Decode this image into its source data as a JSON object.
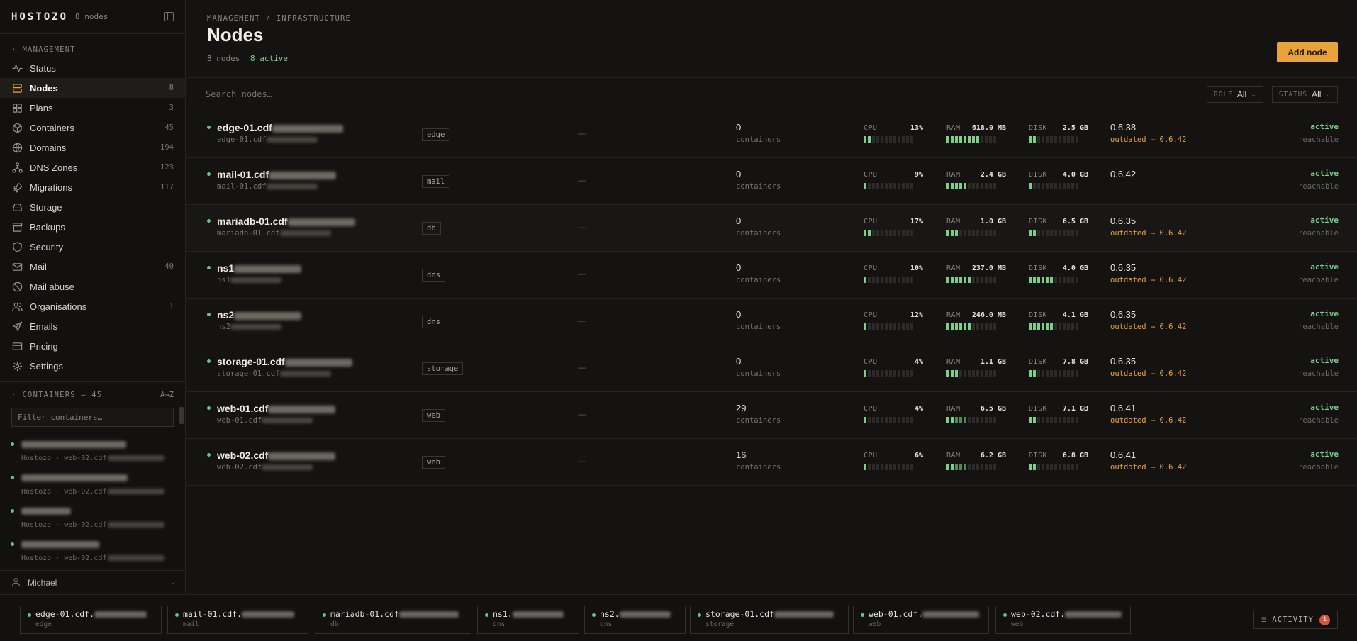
{
  "brand": {
    "logo": "HOSTOZO",
    "count": "8 nodes"
  },
  "sidebar": {
    "section": "MANAGEMENT",
    "items": [
      {
        "label": "Status",
        "icon": "activity-icon",
        "badge": ""
      },
      {
        "label": "Nodes",
        "icon": "server-icon",
        "badge": "8",
        "active": true
      },
      {
        "label": "Plans",
        "icon": "grid-icon",
        "badge": "3"
      },
      {
        "label": "Containers",
        "icon": "box-icon",
        "badge": "45"
      },
      {
        "label": "Domains",
        "icon": "globe-icon",
        "badge": "194"
      },
      {
        "label": "DNS Zones",
        "icon": "network-icon",
        "badge": "123"
      },
      {
        "label": "Migrations",
        "icon": "rocket-icon",
        "badge": "117"
      },
      {
        "label": "Storage",
        "icon": "storage-icon",
        "badge": ""
      },
      {
        "label": "Backups",
        "icon": "archive-icon",
        "badge": ""
      },
      {
        "label": "Security",
        "icon": "shield-icon",
        "badge": ""
      },
      {
        "label": "Mail",
        "icon": "mail-icon",
        "badge": "40"
      },
      {
        "label": "Mail abuse",
        "icon": "ban-icon",
        "badge": ""
      },
      {
        "label": "Organisations",
        "icon": "users-icon",
        "badge": "1"
      },
      {
        "label": "Emails",
        "icon": "send-icon",
        "badge": ""
      },
      {
        "label": "Pricing",
        "icon": "card-icon",
        "badge": ""
      },
      {
        "label": "Settings",
        "icon": "gear-icon",
        "badge": ""
      }
    ],
    "containers_title": "CONTAINERS — 45",
    "containers_sort": "A→Z",
    "filter_placeholder": "Filter containers…",
    "containers": [
      {
        "sub": "Hostozo · web-02.cdf"
      },
      {
        "sub": "Hostozo · web-02.cdf"
      },
      {
        "sub": "Hostozo · web-02.cdf"
      },
      {
        "sub": "Hostozo · web-02.cdf"
      }
    ],
    "user": "Michael",
    "user_more": "⌄"
  },
  "main": {
    "breadcrumb": "MANAGEMENT / INFRASTRUCTURE",
    "title": "Nodes",
    "summary_nodes": "8 nodes",
    "summary_active": "8 active",
    "add_button": "Add node",
    "search_placeholder": "Search nodes…",
    "role_filter": {
      "label": "ROLE",
      "value": "All"
    },
    "status_filter": {
      "label": "STATUS",
      "value": "All"
    }
  },
  "nodes": [
    {
      "name": "edge-01.cdf",
      "host": "edge-01.cdf",
      "role": "edge",
      "dash": "—",
      "containers": "0",
      "containers_label": "containers",
      "cpu": "13%",
      "cpu_level": 2,
      "ram": "618.0 MB",
      "ram_level": 8,
      "disk": "2.5 GB",
      "disk_level": 2,
      "version": "0.6.38",
      "outdated": "outdated → 0.6.42",
      "status": "active",
      "reach": "reachable"
    },
    {
      "name": "mail-01.cdf",
      "host": "mail-01.cdf",
      "role": "mail",
      "dash": "—",
      "containers": "0",
      "containers_label": "containers",
      "cpu": "9%",
      "cpu_level": 1,
      "ram": "2.4 GB",
      "ram_level": 5,
      "disk": "4.0 GB",
      "disk_level": 1,
      "version": "0.6.42",
      "outdated": "",
      "status": "active",
      "reach": "reachable"
    },
    {
      "name": "mariadb-01.cdf",
      "host": "mariadb-01.cdf",
      "role": "db",
      "dash": "—",
      "containers": "0",
      "containers_label": "containers",
      "cpu": "17%",
      "cpu_level": 2,
      "ram": "1.0 GB",
      "ram_level": 3,
      "disk": "6.5 GB",
      "disk_level": 2,
      "version": "0.6.35",
      "outdated": "outdated → 0.6.42",
      "status": "active",
      "reach": "reachable"
    },
    {
      "name": "ns1",
      "host": "ns1",
      "role": "dns",
      "dash": "—",
      "containers": "0",
      "containers_label": "containers",
      "cpu": "10%",
      "cpu_level": 1,
      "ram": "237.0 MB",
      "ram_level": 6,
      "disk": "4.0 GB",
      "disk_level": 6,
      "version": "0.6.35",
      "outdated": "outdated → 0.6.42",
      "status": "active",
      "reach": "reachable"
    },
    {
      "name": "ns2",
      "host": "ns2",
      "role": "dns",
      "dash": "—",
      "containers": "0",
      "containers_label": "containers",
      "cpu": "12%",
      "cpu_level": 1,
      "ram": "246.0 MB",
      "ram_level": 6,
      "disk": "4.1 GB",
      "disk_level": 6,
      "version": "0.6.35",
      "outdated": "outdated → 0.6.42",
      "status": "active",
      "reach": "reachable"
    },
    {
      "name": "storage-01.cdf",
      "host": "storage-01.cdf",
      "role": "storage",
      "dash": "—",
      "containers": "0",
      "containers_label": "containers",
      "cpu": "4%",
      "cpu_level": 1,
      "ram": "1.1 GB",
      "ram_level": 3,
      "disk": "7.8 GB",
      "disk_level": 2,
      "version": "0.6.35",
      "outdated": "outdated → 0.6.42",
      "status": "active",
      "reach": "reachable"
    },
    {
      "name": "web-01.cdf",
      "host": "web-01.cdf",
      "role": "web",
      "dash": "—",
      "containers": "29",
      "containers_label": "containers",
      "cpu": "4%",
      "cpu_level": 1,
      "ram": "6.5 GB",
      "ram_level": 5,
      "disk": "7.1 GB",
      "disk_level": 2,
      "version": "0.6.41",
      "outdated": "outdated → 0.6.42",
      "status": "active",
      "reach": "reachable"
    },
    {
      "name": "web-02.cdf",
      "host": "web-02.cdf",
      "role": "web",
      "dash": "—",
      "containers": "16",
      "containers_label": "containers",
      "cpu": "6%",
      "cpu_level": 1,
      "ram": "6.2 GB",
      "ram_level": 5,
      "disk": "6.8 GB",
      "disk_level": 2,
      "version": "0.6.41",
      "outdated": "outdated → 0.6.42",
      "status": "active",
      "reach": "reachable"
    }
  ],
  "metric_labels": {
    "cpu": "CPU",
    "ram": "RAM",
    "disk": "DISK"
  },
  "dock": [
    {
      "name": "edge-01.cdf.",
      "role": "edge"
    },
    {
      "name": "mail-01.cdf.",
      "role": "mail"
    },
    {
      "name": "mariadb-01.cdf",
      "role": "db"
    },
    {
      "name": "ns1.",
      "role": "dns"
    },
    {
      "name": "ns2.",
      "role": "dns"
    },
    {
      "name": "storage-01.cdf",
      "role": "storage"
    },
    {
      "name": "web-01.cdf.",
      "role": "web"
    },
    {
      "name": "web-02.cdf.",
      "role": "web"
    }
  ],
  "activity": {
    "label": "ACTIVITY",
    "count": "1"
  },
  "colors": {
    "accent": "#e8a33a",
    "ok": "#7bd08a",
    "warn": "#e8a33a",
    "alert": "#d9533f"
  }
}
